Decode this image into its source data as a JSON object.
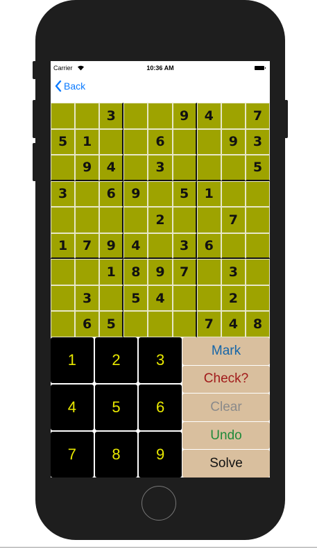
{
  "status_bar": {
    "carrier": "Carrier",
    "time": "10:36 AM"
  },
  "nav": {
    "back_label": "Back"
  },
  "grid": [
    [
      "",
      "",
      "3",
      "",
      "",
      "9",
      "4",
      "",
      "7"
    ],
    [
      "5",
      "1",
      "",
      "",
      "6",
      "",
      "",
      "9",
      "3"
    ],
    [
      "",
      "9",
      "4",
      "",
      "3",
      "",
      "",
      "",
      "5"
    ],
    [
      "3",
      "",
      "6",
      "9",
      "",
      "5",
      "1",
      "",
      ""
    ],
    [
      "",
      "",
      "",
      "",
      "2",
      "",
      "",
      "7",
      ""
    ],
    [
      "1",
      "7",
      "9",
      "4",
      "",
      "3",
      "6",
      "",
      ""
    ],
    [
      "",
      "",
      "1",
      "8",
      "9",
      "7",
      "",
      "3",
      ""
    ],
    [
      "",
      "3",
      "",
      "5",
      "4",
      "",
      "",
      "2",
      ""
    ],
    [
      "",
      "6",
      "5",
      "",
      "",
      "",
      "7",
      "4",
      "8"
    ]
  ],
  "keypad": [
    "1",
    "2",
    "3",
    "4",
    "5",
    "6",
    "7",
    "8",
    "9"
  ],
  "actions": [
    {
      "label": "Mark",
      "color": "#1565a8"
    },
    {
      "label": "Check?",
      "color": "#a11a1a"
    },
    {
      "label": "Clear",
      "color": "#8a8a8a"
    },
    {
      "label": "Undo",
      "color": "#1f8a3a"
    },
    {
      "label": "Solve",
      "color": "#111111"
    }
  ],
  "colors": {
    "cell_bg": "#9ea300",
    "key_text": "#e8e800",
    "action_bg": "#d9bf9e",
    "link": "#0a7aff"
  }
}
